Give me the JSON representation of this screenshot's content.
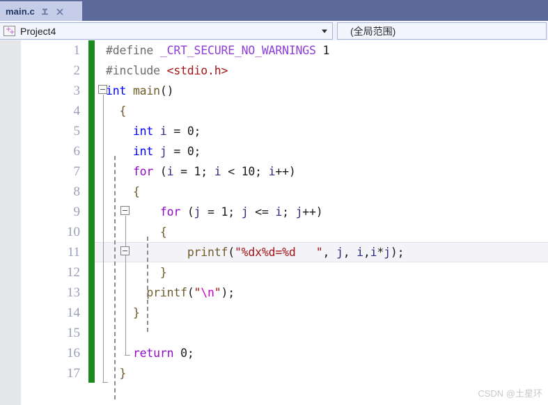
{
  "window": {
    "titlebar_color": "#5b6a9b"
  },
  "tab": {
    "label": "main.c",
    "pin_icon": "pin-icon",
    "close_icon": "close-icon",
    "active": true
  },
  "navbar": {
    "project_icon": "cpp-project-icon",
    "project_name": "Project4",
    "scope_value": "(全局范围)",
    "dropdown_icon": "chevron-down-icon"
  },
  "editor": {
    "change_bar_color": "#1c8a1c",
    "highlight_line": 11,
    "lines": [
      {
        "n": "1",
        "indent": 0
      },
      {
        "n": "2",
        "indent": 0
      },
      {
        "n": "3",
        "indent": 0
      },
      {
        "n": "4",
        "indent": 0
      },
      {
        "n": "5",
        "indent": 0
      },
      {
        "n": "6",
        "indent": 0
      },
      {
        "n": "7",
        "indent": 0
      },
      {
        "n": "8",
        "indent": 0
      },
      {
        "n": "9",
        "indent": 0
      },
      {
        "n": "10",
        "indent": 0
      },
      {
        "n": "11",
        "indent": 0
      },
      {
        "n": "12",
        "indent": 0
      },
      {
        "n": "13",
        "indent": 0
      },
      {
        "n": "14",
        "indent": 0
      },
      {
        "n": "15",
        "indent": 0
      },
      {
        "n": "16",
        "indent": 0
      },
      {
        "n": "17",
        "indent": 0
      }
    ],
    "code_text": [
      "#define _CRT_SECURE_NO_WARNINGS 1",
      "#include <stdio.h>",
      "int main()",
      "{",
      "    int i = 0;",
      "    int j = 0;",
      "    for (i = 1; i < 10; i++)",
      "    {",
      "        for (j = 1; j <= i; j++)",
      "        {",
      "            printf(\"%dx%d=%d   \", j, i,i*j);",
      "        }",
      "        printf(\"\\n\");",
      "    }",
      "",
      "    return 0;",
      "}"
    ]
  },
  "watermark": {
    "text": "CSDN @土星环"
  }
}
